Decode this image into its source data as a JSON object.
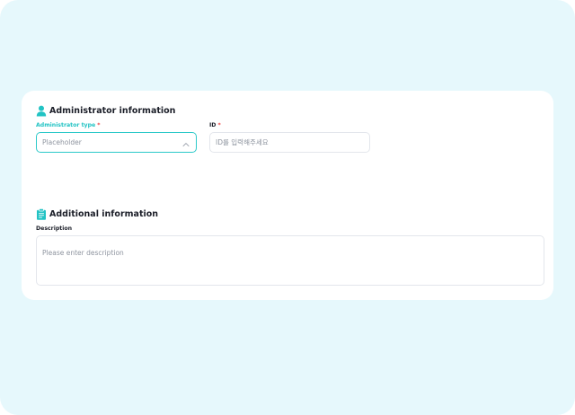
{
  "admin_section": {
    "title": "Administrator information",
    "icon": "user-icon",
    "type_field": {
      "label": "Administrator type",
      "required_mark": "*",
      "placeholder": "Placeholder",
      "icon": "chevron-up-icon"
    },
    "id_field": {
      "label": "ID",
      "required_mark": "*",
      "placeholder": "ID를 입력해주세요"
    }
  },
  "additional_section": {
    "title": "Additional information",
    "icon": "clipboard-icon",
    "description_field": {
      "label": "Description",
      "placeholder": "Please enter description"
    }
  },
  "colors": {
    "background": "#e6f8fc",
    "accent": "#22c3c4",
    "required": "#ef4444"
  }
}
